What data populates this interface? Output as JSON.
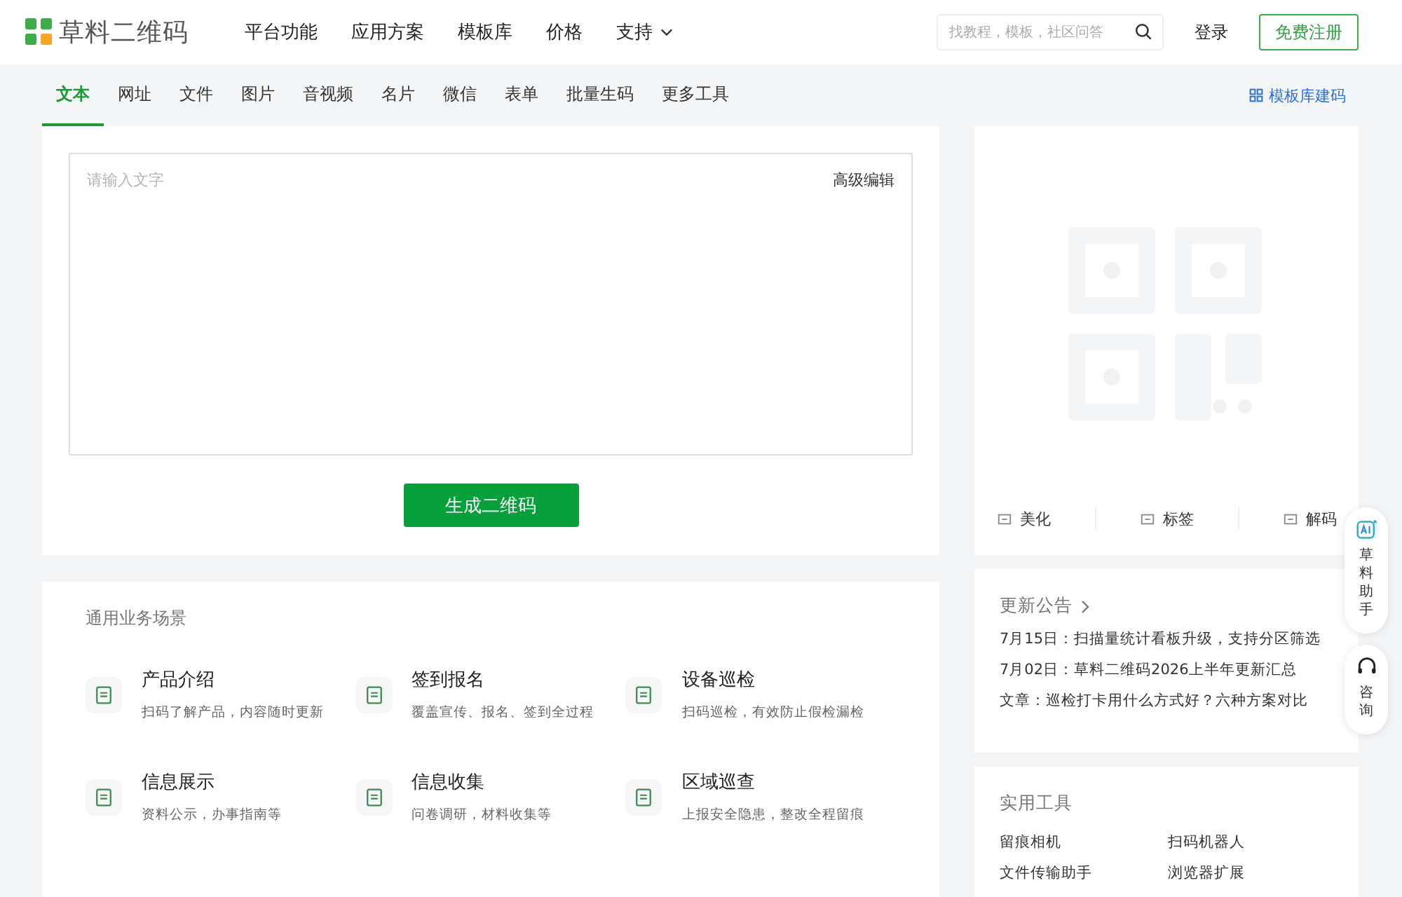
{
  "header": {
    "logo": "草料二维码",
    "nav": [
      {
        "label": "平台功能",
        "dropdown": false
      },
      {
        "label": "应用方案",
        "dropdown": false
      },
      {
        "label": "模板库",
        "dropdown": false
      },
      {
        "label": "价格",
        "dropdown": false
      },
      {
        "label": "支持",
        "dropdown": true
      }
    ],
    "search": {
      "placeholder": "找教程，模板，社区问答"
    },
    "login": "登录",
    "register": "免费注册"
  },
  "tabs": [
    {
      "label": "文本",
      "selected": true
    },
    {
      "label": "网址",
      "selected": false
    },
    {
      "label": "文件",
      "selected": false
    },
    {
      "label": "图片",
      "selected": false
    },
    {
      "label": "音视频",
      "selected": false
    },
    {
      "label": "名片",
      "selected": false
    },
    {
      "label": "微信",
      "selected": false
    },
    {
      "label": "表单",
      "selected": false
    },
    {
      "label": "批量生码",
      "selected": false
    },
    {
      "label": "更多工具",
      "selected": false
    }
  ],
  "template_link": "模板库建码",
  "editor": {
    "placeholder": "请输入文字",
    "advanced": "高级编辑",
    "generate": "生成二维码"
  },
  "qr_actions": [
    "美化",
    "标签",
    "解码"
  ],
  "scenarios": {
    "title": "通用业务场景",
    "items": [
      {
        "title": "产品介绍",
        "desc": "扫码了解产品，内容随时更新"
      },
      {
        "title": "签到报名",
        "desc": "覆盖宣传、报名、签到全过程"
      },
      {
        "title": "设备巡检",
        "desc": "扫码巡检，有效防止假检漏检"
      },
      {
        "title": "信息展示",
        "desc": "资料公示，办事指南等"
      },
      {
        "title": "信息收集",
        "desc": "问卷调研，材料收集等"
      },
      {
        "title": "区域巡查",
        "desc": "上报安全隐患，整改全程留痕"
      }
    ]
  },
  "notices": {
    "title": "更新公告",
    "items": [
      "7月15日：扫描量统计看板升级，支持分区筛选",
      "7月02日：草料二维码2026上半年更新汇总",
      "文章：巡检打卡用什么方式好？六种方案对比"
    ]
  },
  "tools": {
    "title": "实用工具",
    "items": [
      "留痕相机",
      "扫码机器人",
      "文件传输助手",
      "浏览器扩展"
    ]
  },
  "float": [
    {
      "label": "草料助手",
      "kind": "ai"
    },
    {
      "label": "咨询",
      "kind": "headset"
    }
  ]
}
